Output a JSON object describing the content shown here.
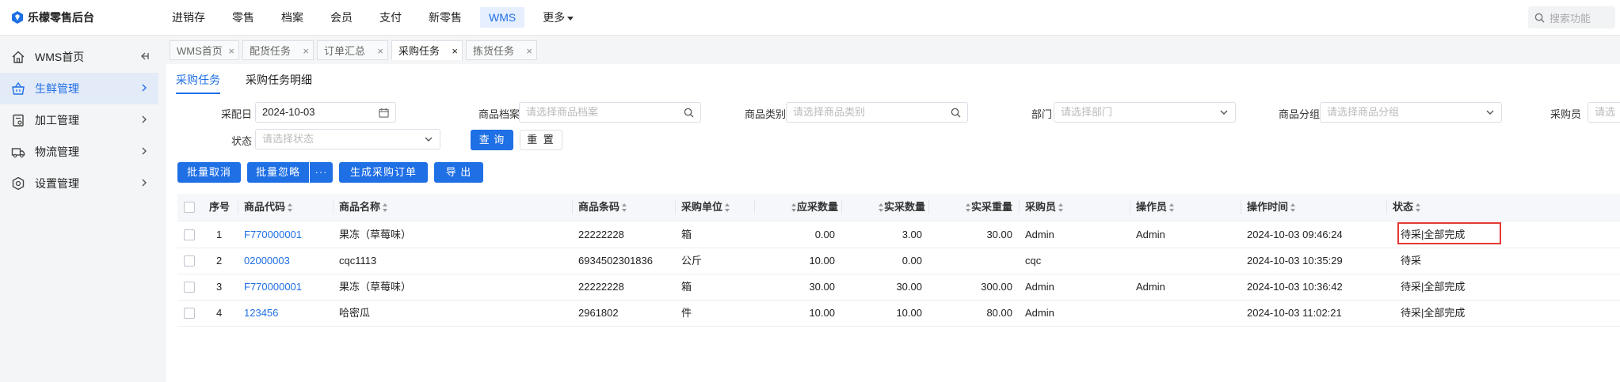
{
  "app": {
    "title": "乐檬零售后台"
  },
  "top_nav": [
    {
      "label": "进销存"
    },
    {
      "label": "零售"
    },
    {
      "label": "档案"
    },
    {
      "label": "会员"
    },
    {
      "label": "支付"
    },
    {
      "label": "新零售"
    },
    {
      "label": "WMS"
    },
    {
      "label": "更多"
    }
  ],
  "top_search": {
    "placeholder": "搜索功能"
  },
  "sidebar": {
    "items": [
      {
        "label": "WMS首页"
      },
      {
        "label": "生鲜管理"
      },
      {
        "label": "加工管理"
      },
      {
        "label": "物流管理"
      },
      {
        "label": "设置管理"
      }
    ]
  },
  "page_tabs": [
    {
      "label": "WMS首页"
    },
    {
      "label": "配货任务"
    },
    {
      "label": "订单汇总"
    },
    {
      "label": "采购任务"
    },
    {
      "label": "拣货任务"
    }
  ],
  "sub_tabs": [
    {
      "label": "采购任务"
    },
    {
      "label": "采购任务明细"
    }
  ],
  "filters": {
    "date": {
      "label": "采配日",
      "value": "2024-10-03"
    },
    "product": {
      "label": "商品档案",
      "placeholder": "请选择商品档案"
    },
    "category": {
      "label": "商品类别",
      "placeholder": "请选择商品类别"
    },
    "dept": {
      "label": "部门",
      "placeholder": "请选择部门"
    },
    "group": {
      "label": "商品分组",
      "placeholder": "请选择商品分组"
    },
    "buyer": {
      "label": "采购员",
      "placeholder": "请选"
    },
    "status": {
      "label": "状态",
      "placeholder": "请选择状态"
    },
    "query_label": "查 询",
    "reset_label": "重 置"
  },
  "actions": {
    "batch_cancel": "批量取消",
    "batch_ignore": "批量忽略",
    "more": "···",
    "gen_order": "生成采购订单",
    "export": "导 出"
  },
  "table": {
    "headers": {
      "seq": "序号",
      "code": "商品代码",
      "name": "商品名称",
      "barcode": "商品条码",
      "unit": "采购单位",
      "due_qty": "应采数量",
      "real_qty": "实采数量",
      "real_weight": "实采重量",
      "buyer": "采购员",
      "operator": "操作员",
      "op_time": "操作时间",
      "status": "状态"
    },
    "rows": [
      {
        "seq": "1",
        "code": "F770000001",
        "name": "果冻（草莓味）",
        "barcode": "22222228",
        "unit": "箱",
        "due_qty": "0.00",
        "real_qty": "3.00",
        "real_weight": "30.00",
        "buyer": "Admin",
        "operator": "Admin",
        "op_time": "2024-10-03 09:46:24",
        "status": "待采|全部完成"
      },
      {
        "seq": "2",
        "code": "02000003",
        "name": "cqc1113",
        "barcode": "6934502301836",
        "unit": "公斤",
        "due_qty": "10.00",
        "real_qty": "0.00",
        "real_weight": "",
        "buyer": "cqc",
        "operator": "",
        "op_time": "2024-10-03 10:35:29",
        "status": "待采"
      },
      {
        "seq": "3",
        "code": "F770000001",
        "name": "果冻（草莓味）",
        "barcode": "22222228",
        "unit": "箱",
        "due_qty": "30.00",
        "real_qty": "30.00",
        "real_weight": "300.00",
        "buyer": "Admin",
        "operator": "Admin",
        "op_time": "2024-10-03 10:36:42",
        "status": "待采|全部完成"
      },
      {
        "seq": "4",
        "code": "123456",
        "name": "哈密瓜",
        "barcode": "2961802",
        "unit": "件",
        "due_qty": "10.00",
        "real_qty": "10.00",
        "real_weight": "80.00",
        "buyer": "Admin",
        "operator": "",
        "op_time": "2024-10-03 11:02:21",
        "status": "待采|全部完成"
      }
    ]
  },
  "colors": {
    "accent": "#1f6fe5",
    "highlight": "#e53935"
  }
}
